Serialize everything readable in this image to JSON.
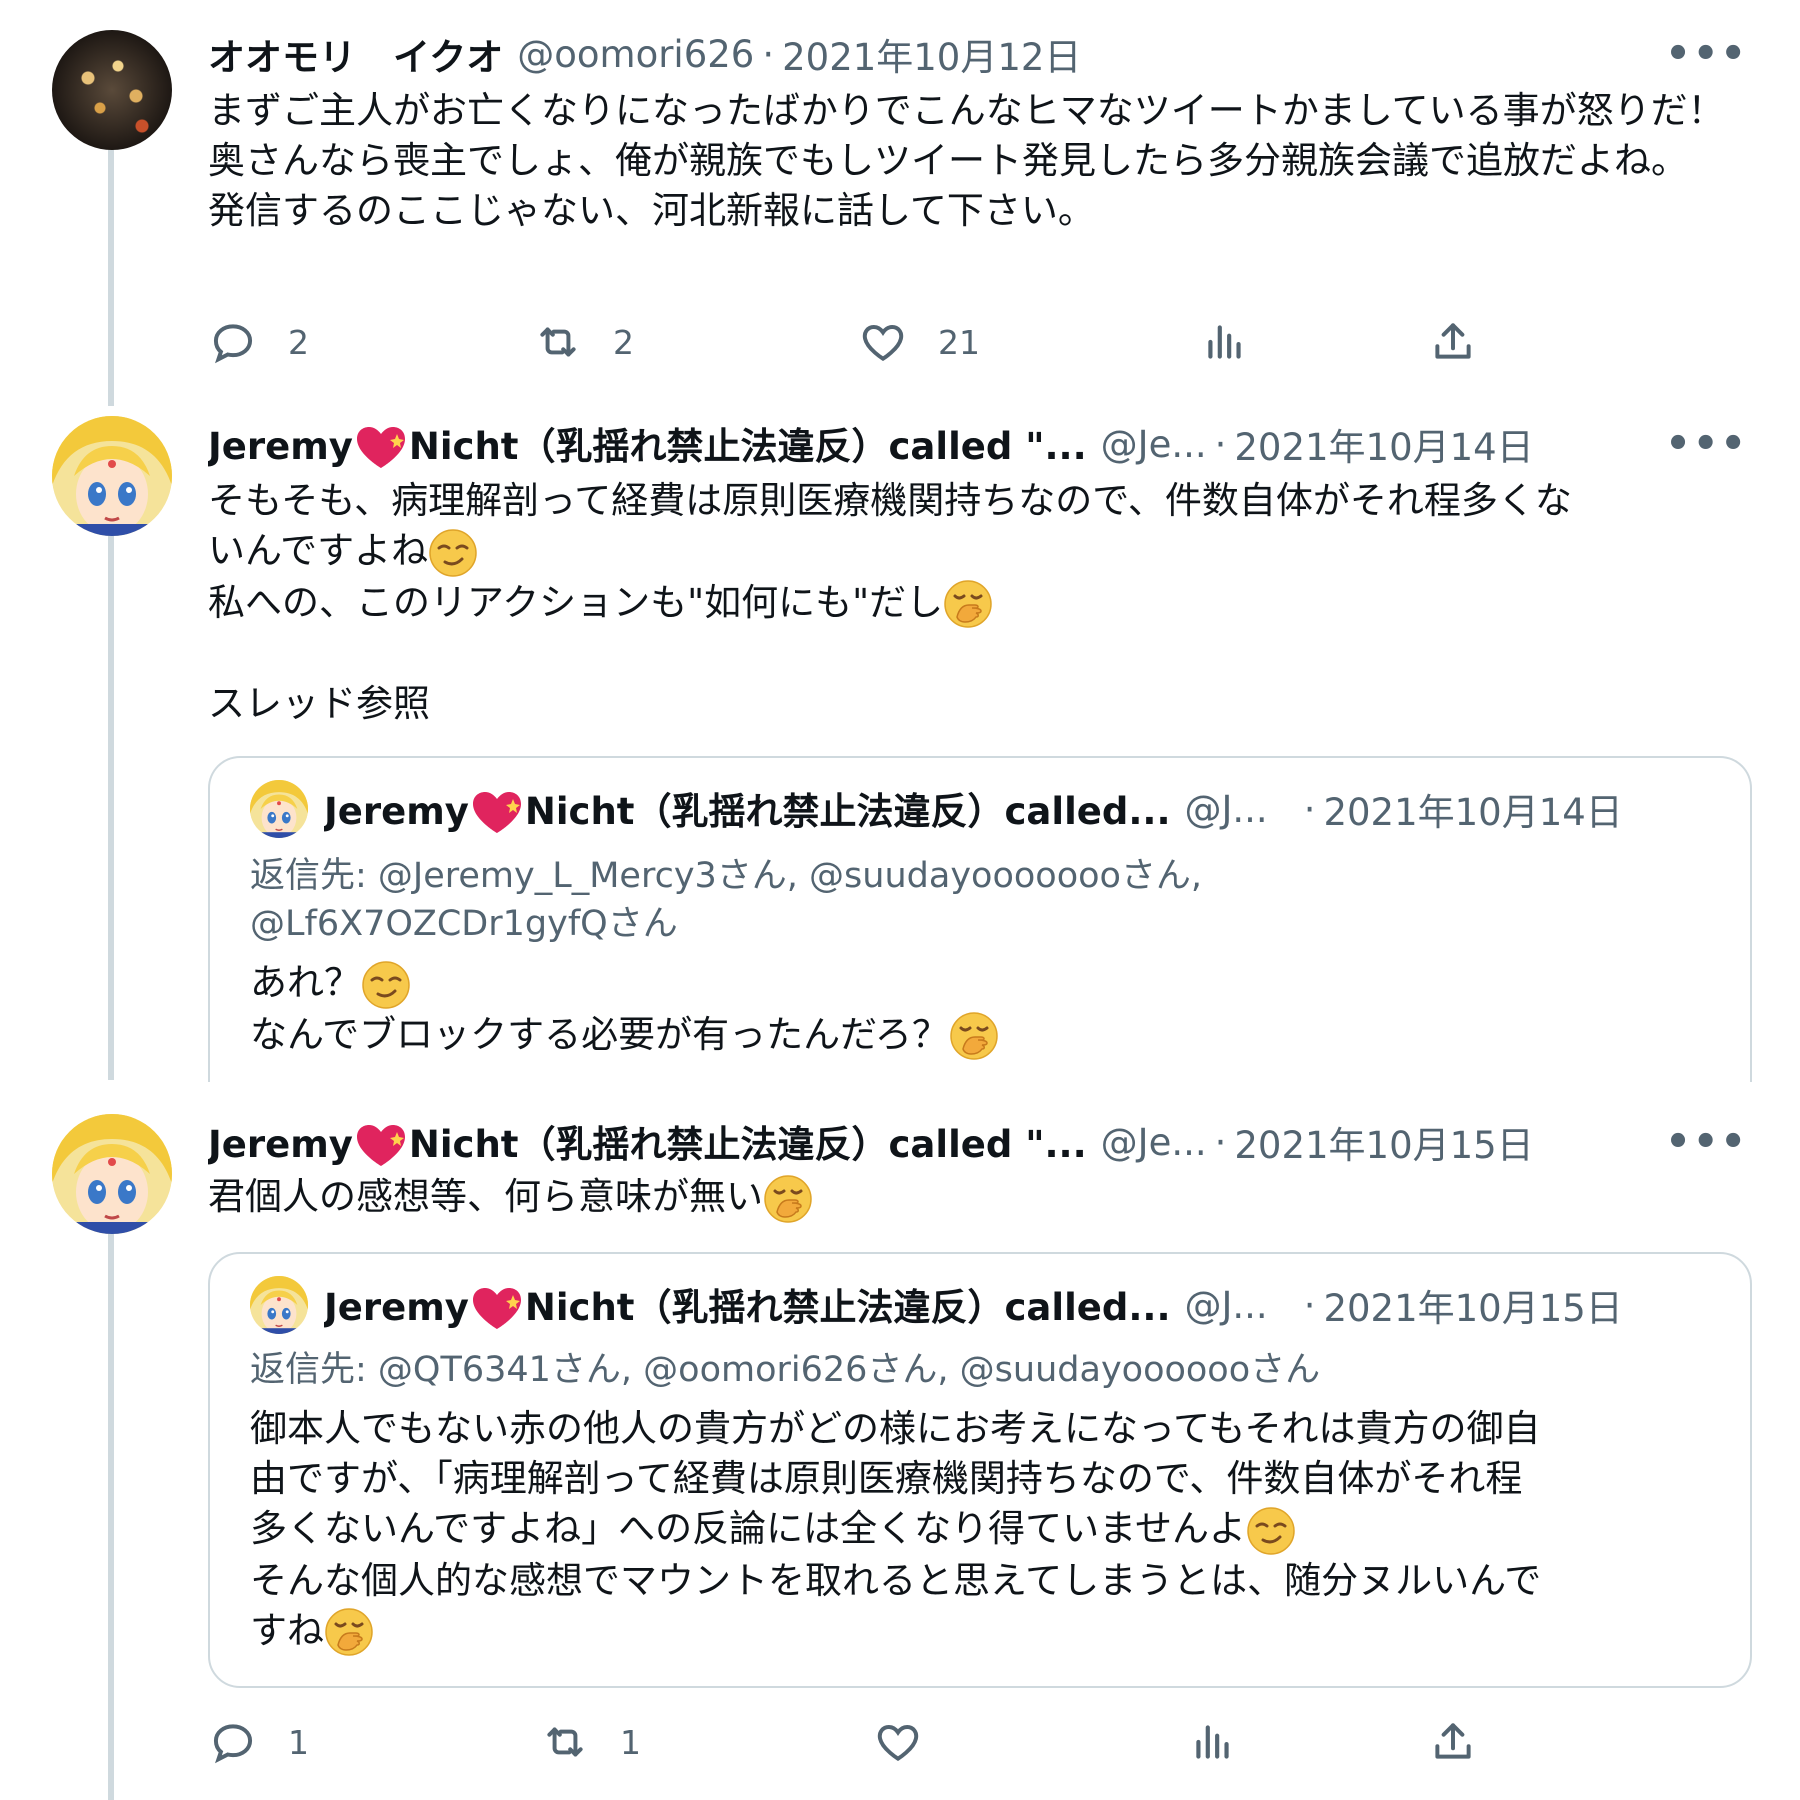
{
  "tweets": [
    {
      "name": "オオモリ　イクオ",
      "handle": "@oomori626",
      "date": "2021年10月12日",
      "text": "まずご主人がお亡くなりになったばかりでこんなヒマなツイートかましている事が怒りだ！奥さんなら喪主でしょ、俺が親族でもしツイート発見したら多分親族会議で追放だよね。\n発信するのここじゃない、河北新報に話して下さい。",
      "replies": "2",
      "retweets": "2",
      "likes": "21"
    },
    {
      "name_part1": "Jeremy",
      "name_part2": "Nicht（乳揺れ禁止法違反）called \"...",
      "handle": "@Je...",
      "date": "2021年10月14日",
      "line1": "そもそも、病理解剖って経費は原則医療機関持ちなので、件数自体がそれ程多くな",
      "line2": "いんですよね",
      "line3": "私への、このリアクションも\"如何にも\"だし",
      "line4": "スレッド参照",
      "quote": {
        "name_part1": "Jeremy",
        "name_part2": "Nicht（乳揺れ禁止法違反）called...",
        "handle": "@J...",
        "date": "2021年10月14日",
        "replying": "返信先: @Jeremy_L_Mercy3さん, @suudayoooooooさん,\n@Lf6X7OZCDr1gyfQさん",
        "line1": "あれ？",
        "line2": "なんでブロックする必要が有ったんだろ？"
      }
    },
    {
      "name_part1": "Jeremy",
      "name_part2": "Nicht（乳揺れ禁止法違反）called \"...",
      "handle": "@Je...",
      "date": "2021年10月15日",
      "line1": "君個人の感想等、何ら意味が無い",
      "quote": {
        "name_part1": "Jeremy",
        "name_part2": "Nicht（乳揺れ禁止法違反）called...",
        "handle": "@J...",
        "date": "2021年10月15日",
        "replying": "返信先: @QT6341さん, @oomori626さん, @suudayooooooさん",
        "line1": "御本人でもない赤の他人の貴方がどの様にお考えになってもそれは貴方の御自",
        "line2": "由ですが、「病理解剖って経費は原則医療機関持ちなので、件数自体がそれ程",
        "line3": "多くないんですよね」への反論には全くなり得ていませんよ",
        "line4": "そんな個人的な感想でマウントを取れると思えてしまうとは、随分ヌルいんで",
        "line5": "すね"
      },
      "replies": "1",
      "retweets": "1"
    }
  ],
  "icons": {
    "reply": "reply-icon",
    "retweet": "retweet-icon",
    "like": "heart-icon",
    "views": "views-icon",
    "share": "share-icon",
    "more": "more-icon",
    "smirk": "smirk-emoji",
    "hand_over_mouth": "hand-over-mouth-emoji"
  },
  "colors": {
    "text": "#0f1419",
    "secondary": "#536471",
    "border": "#cfd9de",
    "heart_red": "#e0245e"
  }
}
